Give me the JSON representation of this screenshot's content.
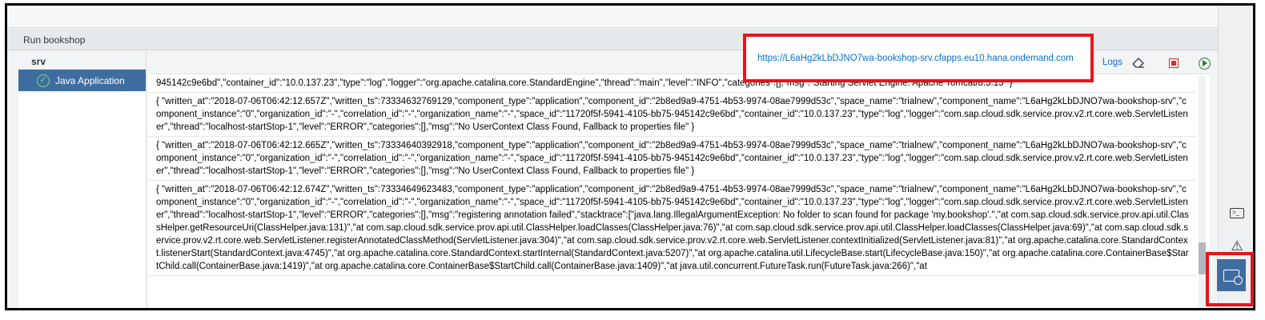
{
  "panel": {
    "title": "Run bookshop"
  },
  "sidebar": {
    "group_label": "srv",
    "items": [
      {
        "label": "Java Application",
        "status": "success"
      }
    ]
  },
  "toolbar": {
    "url": "https://L6aHg2kLbDJNO7wa-bookshop-srv.cfapps.eu10.hana.ondemand.com",
    "logs_label": "Logs",
    "icons": [
      "eraser-icon",
      "stop-icon",
      "run-icon"
    ]
  },
  "log": {
    "entries": [
      "945142c9e6bd\",\"container_id\":\"10.0.137.23\",\"type\":\"log\",\"logger\":\"org.apache.catalina.core.StandardEngine\",\"thread\":\"main\",\"level\":\"INFO\",\"categories\":[],\"msg\":\"Starting Servlet Engine: Apache Tomcat/8.5.15\" }",
      "{ \"written_at\":\"2018-07-06T06:42:12.657Z\",\"written_ts\":73334632769129,\"component_type\":\"application\",\"component_id\":\"2b8ed9a9-4751-4b53-9974-08ae7999d53c\",\"space_name\":\"trialnew\",\"component_name\":\"L6aHg2kLbDJNO7wa-bookshop-srv\",\"component_instance\":\"0\",\"organization_id\":\"-\",\"correlation_id\":\"-\",\"organization_name\":\"-\",\"space_id\":\"11720f5f-5941-4105-bb75-945142c9e6bd\",\"container_id\":\"10.0.137.23\",\"type\":\"log\",\"logger\":\"com.sap.cloud.sdk.service.prov.v2.rt.core.web.ServletListener\",\"thread\":\"localhost-startStop-1\",\"level\":\"ERROR\",\"categories\":[],\"msg\":\"No UserContext Class Found, Fallback to properties file\" }",
      "{ \"written_at\":\"2018-07-06T06:42:12.665Z\",\"written_ts\":73334640392918,\"component_type\":\"application\",\"component_id\":\"2b8ed9a9-4751-4b53-9974-08ae7999d53c\",\"space_name\":\"trialnew\",\"component_name\":\"L6aHg2kLbDJNO7wa-bookshop-srv\",\"component_instance\":\"0\",\"organization_id\":\"-\",\"correlation_id\":\"-\",\"organization_name\":\"-\",\"space_id\":\"11720f5f-5941-4105-bb75-945142c9e6bd\",\"container_id\":\"10.0.137.23\",\"type\":\"log\",\"logger\":\"com.sap.cloud.sdk.service.prov.v2.rt.core.web.ServletListener\",\"thread\":\"localhost-startStop-1\",\"level\":\"ERROR\",\"categories\":[],\"msg\":\"No UserContext Class Found, Fallback to properties file\" }",
      "{ \"written_at\":\"2018-07-06T06:42:12.674Z\",\"written_ts\":73334649623483,\"component_type\":\"application\",\"component_id\":\"2b8ed9a9-4751-4b53-9974-08ae7999d53c\",\"space_name\":\"trialnew\",\"component_name\":\"L6aHg2kLbDJNO7wa-bookshop-srv\",\"component_instance\":\"0\",\"organization_id\":\"-\",\"correlation_id\":\"-\",\"organization_name\":\"-\",\"space_id\":\"11720f5f-5941-4105-bb75-945142c9e6bd\",\"container_id\":\"10.0.137.23\",\"type\":\"log\",\"logger\":\"com.sap.cloud.sdk.service.prov.v2.rt.core.web.ServletListener\",\"thread\":\"localhost-startStop-1\",\"level\":\"ERROR\",\"categories\":[],\"msg\":\"registering annotation failed\",\"stacktrace\":[\"java.lang.IllegalArgumentException: No folder to scan found for package 'my.bookshop'.\",\"at com.sap.cloud.sdk.service.prov.api.util.ClassHelper.getResourceUri(ClassHelper.java:131)\",\"at com.sap.cloud.sdk.service.prov.api.util.ClassHelper.loadClasses(ClassHelper.java:76)\",\"at com.sap.cloud.sdk.service.prov.api.util.ClassHelper.loadClasses(ClassHelper.java:69)\",\"at com.sap.cloud.sdk.service.prov.v2.rt.core.web.ServletListener.registerAnnotatedClassMethod(ServletListener.java:304)\",\"at com.sap.cloud.sdk.service.prov.v2.rt.core.web.ServletListener.contextInitialized(ServletListener.java:81)\",\"at org.apache.catalina.core.StandardContext.listenerStart(StandardContext.java:4745)\",\"at org.apache.catalina.core.StandardContext.startInternal(StandardContext.java:5207)\",\"at org.apache.catalina.util.LifecycleBase.start(LifecycleBase.java:150)\",\"at org.apache.catalina.core.ContainerBase$StartChild.call(ContainerBase.java:1419)\",\"at org.apache.catalina.core.ContainerBase$StartChild.call(ContainerBase.java:1409)\",\"at java.util.concurrent.FutureTask.run(FutureTask.java:266)\",\"at"
    ]
  },
  "rail": {
    "icons": [
      "console-icon",
      "warning-icon",
      "run-console-icon"
    ]
  },
  "colors": {
    "accent": "#3f6d9f",
    "link": "#0a6ed1",
    "highlight": "#e8141c",
    "stop": "#e52929",
    "run": "#2b7c2b"
  }
}
